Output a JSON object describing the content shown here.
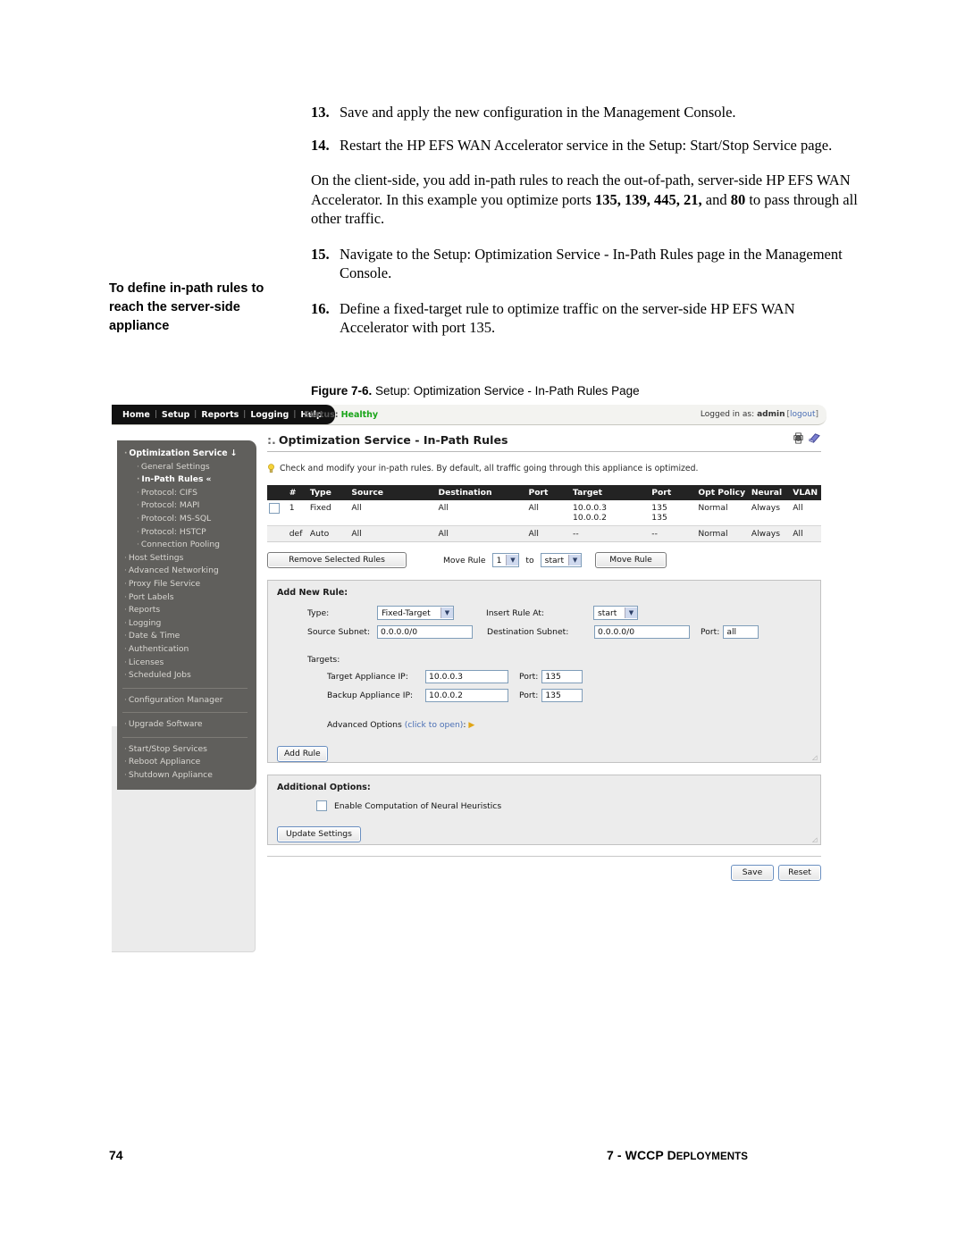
{
  "document": {
    "steps": [
      {
        "num": "13.",
        "text": "Save and apply the new configuration in the Management Console."
      },
      {
        "num": "14.",
        "text": "Restart the HP EFS WAN Accelerator service in the Setup: Start/Stop Service page."
      },
      {
        "num": "15.",
        "text": "Navigate to the Setup: Optimization Service - In-Path Rules page in the Management Console."
      },
      {
        "num": "16.",
        "text": "Define a fixed-target rule to optimize traffic on the server-side HP EFS WAN Accelerator with port 135."
      }
    ],
    "paragraph_lead": "On the client-side, you add in-path rules to reach the out-of-path, server-side HP EFS WAN Accelerator. In this example you optimize ports ",
    "paragraph_ports": "135, 139, 445, 21,",
    "paragraph_mid": " and ",
    "paragraph_port80": "80",
    "paragraph_tail": " to pass through all other traffic.",
    "margin_heading": "To define in-path rules to reach the server-side appliance",
    "figure_label": "Figure 7-6.",
    "figure_caption": "Setup: Optimization Service - In-Path Rules Page",
    "footer_page": "74",
    "footer_chapter_num": "7 - ",
    "footer_chapter_wccp": "WCCP ",
    "footer_chapter_d": "D",
    "footer_chapter_rest": "EPLOYMENTS"
  },
  "screenshot": {
    "nav": {
      "items": [
        "Home",
        "Setup",
        "Reports",
        "Logging",
        "Help"
      ],
      "separator": "|"
    },
    "status": {
      "label": "Status:",
      "value": "Healthy",
      "color": "#19a519"
    },
    "session": {
      "label": "Logged in as:",
      "user": "admin",
      "bracket_open": "[",
      "logout": "logout",
      "bracket_close": "]"
    },
    "sidebar": {
      "items": [
        {
          "label": "Optimization Service",
          "suffix": "↓",
          "level": 1,
          "style": "head"
        },
        {
          "label": "General Settings",
          "level": 2,
          "style": "normal"
        },
        {
          "label": "In-Path Rules",
          "suffix": "«",
          "level": 2,
          "style": "sel"
        },
        {
          "label": "Protocol: CIFS",
          "level": 2,
          "style": "normal"
        },
        {
          "label": "Protocol: MAPI",
          "level": 2,
          "style": "normal"
        },
        {
          "label": "Protocol: MS-SQL",
          "level": 2,
          "style": "normal"
        },
        {
          "label": "Protocol: HSTCP",
          "level": 2,
          "style": "normal"
        },
        {
          "label": "Connection Pooling",
          "level": 2,
          "style": "normal"
        },
        {
          "label": "Host Settings",
          "level": 1,
          "style": "normal"
        },
        {
          "label": "Advanced Networking",
          "level": 1,
          "style": "normal"
        },
        {
          "label": "Proxy File Service",
          "level": 1,
          "style": "normal"
        },
        {
          "label": "Port Labels",
          "level": 1,
          "style": "normal"
        },
        {
          "label": "Reports",
          "level": 1,
          "style": "normal"
        },
        {
          "label": "Logging",
          "level": 1,
          "style": "normal"
        },
        {
          "label": "Date & Time",
          "level": 1,
          "style": "normal"
        },
        {
          "label": "Authentication",
          "level": 1,
          "style": "normal"
        },
        {
          "label": "Licenses",
          "level": 1,
          "style": "normal"
        },
        {
          "label": "Scheduled Jobs",
          "level": 1,
          "style": "normal"
        },
        {
          "label": "__divider__",
          "level": 0,
          "style": "divider"
        },
        {
          "label": "Configuration Manager",
          "level": 1,
          "style": "normal"
        },
        {
          "label": "__divider__",
          "level": 0,
          "style": "divider"
        },
        {
          "label": "Upgrade Software",
          "level": 1,
          "style": "normal"
        },
        {
          "label": "__divider__",
          "level": 0,
          "style": "divider"
        },
        {
          "label": "Start/Stop Services",
          "level": 1,
          "style": "normal"
        },
        {
          "label": "Reboot Appliance",
          "level": 1,
          "style": "normal"
        },
        {
          "label": "Shutdown Appliance",
          "level": 1,
          "style": "normal"
        }
      ]
    },
    "panel": {
      "title_prefix": ":.",
      "title": "Optimization Service - In-Path Rules",
      "tip": "Check and modify your in-path rules. By default, all traffic going through this appliance is optimized."
    },
    "rules_table": {
      "headers": [
        "",
        "#",
        "Type",
        "Source",
        "Destination",
        "Port",
        "Target",
        "Port",
        "Opt Policy",
        "Neural",
        "VLAN"
      ],
      "rows": [
        {
          "checkbox": true,
          "num": "1",
          "type": "Fixed",
          "source": "All",
          "destination": "All",
          "port": "All",
          "target": "10.0.0.3\n10.0.0.2",
          "target_port": "135\n135",
          "opt_policy": "Normal",
          "neural": "Always",
          "vlan": "All"
        },
        {
          "checkbox": false,
          "num": "def",
          "type": "Auto",
          "source": "All",
          "destination": "All",
          "port": "All",
          "target": "--",
          "target_port": "--",
          "opt_policy": "Normal",
          "neural": "Always",
          "vlan": "All"
        }
      ]
    },
    "toolbar": {
      "remove_button": "Remove Selected Rules",
      "move_rule_label": "Move Rule",
      "move_rule_value": "1",
      "to_label": "to",
      "move_target_value": "start",
      "move_button": "Move Rule"
    },
    "add_new_rule": {
      "title": "Add New Rule:",
      "type_label": "Type:",
      "type_value": "Fixed-Target",
      "insert_label": "Insert Rule At:",
      "insert_value": "start",
      "source_subnet_label": "Source Subnet:",
      "source_subnet_value": "0.0.0.0/0",
      "dest_subnet_label": "Destination Subnet:",
      "dest_subnet_value": "0.0.0.0/0",
      "port_label": "Port:",
      "port_value": "all",
      "targets_label": "Targets:",
      "target_ip_label": "Target Appliance IP:",
      "target_ip_value": "10.0.0.3",
      "target_port_label": "Port:",
      "target_port_value": "135",
      "backup_ip_label": "Backup Appliance IP:",
      "backup_ip_value": "10.0.0.2",
      "backup_port_label": "Port:",
      "backup_port_value": "135",
      "advanced_label": "Advanced Options",
      "advanced_link": "(click to open)",
      "advanced_colon": ":",
      "add_button": "Add Rule"
    },
    "additional_options": {
      "title": "Additional Options:",
      "checkbox_label": "Enable Computation of Neural Heuristics",
      "checkbox_checked": false,
      "update_button": "Update Settings"
    },
    "footer_buttons": {
      "save": "Save",
      "reset": "Reset"
    }
  }
}
